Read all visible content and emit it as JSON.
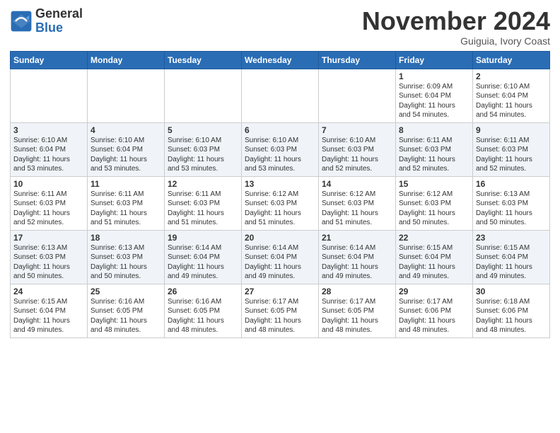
{
  "logo": {
    "general": "General",
    "blue": "Blue"
  },
  "header": {
    "month": "November 2024",
    "location": "Guiguia, Ivory Coast"
  },
  "weekdays": [
    "Sunday",
    "Monday",
    "Tuesday",
    "Wednesday",
    "Thursday",
    "Friday",
    "Saturday"
  ],
  "weeks": [
    [
      {
        "day": "",
        "info": ""
      },
      {
        "day": "",
        "info": ""
      },
      {
        "day": "",
        "info": ""
      },
      {
        "day": "",
        "info": ""
      },
      {
        "day": "",
        "info": ""
      },
      {
        "day": "1",
        "info": "Sunrise: 6:09 AM\nSunset: 6:04 PM\nDaylight: 11 hours\nand 54 minutes."
      },
      {
        "day": "2",
        "info": "Sunrise: 6:10 AM\nSunset: 6:04 PM\nDaylight: 11 hours\nand 54 minutes."
      }
    ],
    [
      {
        "day": "3",
        "info": "Sunrise: 6:10 AM\nSunset: 6:04 PM\nDaylight: 11 hours\nand 53 minutes."
      },
      {
        "day": "4",
        "info": "Sunrise: 6:10 AM\nSunset: 6:04 PM\nDaylight: 11 hours\nand 53 minutes."
      },
      {
        "day": "5",
        "info": "Sunrise: 6:10 AM\nSunset: 6:03 PM\nDaylight: 11 hours\nand 53 minutes."
      },
      {
        "day": "6",
        "info": "Sunrise: 6:10 AM\nSunset: 6:03 PM\nDaylight: 11 hours\nand 53 minutes."
      },
      {
        "day": "7",
        "info": "Sunrise: 6:10 AM\nSunset: 6:03 PM\nDaylight: 11 hours\nand 52 minutes."
      },
      {
        "day": "8",
        "info": "Sunrise: 6:11 AM\nSunset: 6:03 PM\nDaylight: 11 hours\nand 52 minutes."
      },
      {
        "day": "9",
        "info": "Sunrise: 6:11 AM\nSunset: 6:03 PM\nDaylight: 11 hours\nand 52 minutes."
      }
    ],
    [
      {
        "day": "10",
        "info": "Sunrise: 6:11 AM\nSunset: 6:03 PM\nDaylight: 11 hours\nand 52 minutes."
      },
      {
        "day": "11",
        "info": "Sunrise: 6:11 AM\nSunset: 6:03 PM\nDaylight: 11 hours\nand 51 minutes."
      },
      {
        "day": "12",
        "info": "Sunrise: 6:11 AM\nSunset: 6:03 PM\nDaylight: 11 hours\nand 51 minutes."
      },
      {
        "day": "13",
        "info": "Sunrise: 6:12 AM\nSunset: 6:03 PM\nDaylight: 11 hours\nand 51 minutes."
      },
      {
        "day": "14",
        "info": "Sunrise: 6:12 AM\nSunset: 6:03 PM\nDaylight: 11 hours\nand 51 minutes."
      },
      {
        "day": "15",
        "info": "Sunrise: 6:12 AM\nSunset: 6:03 PM\nDaylight: 11 hours\nand 50 minutes."
      },
      {
        "day": "16",
        "info": "Sunrise: 6:13 AM\nSunset: 6:03 PM\nDaylight: 11 hours\nand 50 minutes."
      }
    ],
    [
      {
        "day": "17",
        "info": "Sunrise: 6:13 AM\nSunset: 6:03 PM\nDaylight: 11 hours\nand 50 minutes."
      },
      {
        "day": "18",
        "info": "Sunrise: 6:13 AM\nSunset: 6:03 PM\nDaylight: 11 hours\nand 50 minutes."
      },
      {
        "day": "19",
        "info": "Sunrise: 6:14 AM\nSunset: 6:04 PM\nDaylight: 11 hours\nand 49 minutes."
      },
      {
        "day": "20",
        "info": "Sunrise: 6:14 AM\nSunset: 6:04 PM\nDaylight: 11 hours\nand 49 minutes."
      },
      {
        "day": "21",
        "info": "Sunrise: 6:14 AM\nSunset: 6:04 PM\nDaylight: 11 hours\nand 49 minutes."
      },
      {
        "day": "22",
        "info": "Sunrise: 6:15 AM\nSunset: 6:04 PM\nDaylight: 11 hours\nand 49 minutes."
      },
      {
        "day": "23",
        "info": "Sunrise: 6:15 AM\nSunset: 6:04 PM\nDaylight: 11 hours\nand 49 minutes."
      }
    ],
    [
      {
        "day": "24",
        "info": "Sunrise: 6:15 AM\nSunset: 6:04 PM\nDaylight: 11 hours\nand 49 minutes."
      },
      {
        "day": "25",
        "info": "Sunrise: 6:16 AM\nSunset: 6:05 PM\nDaylight: 11 hours\nand 48 minutes."
      },
      {
        "day": "26",
        "info": "Sunrise: 6:16 AM\nSunset: 6:05 PM\nDaylight: 11 hours\nand 48 minutes."
      },
      {
        "day": "27",
        "info": "Sunrise: 6:17 AM\nSunset: 6:05 PM\nDaylight: 11 hours\nand 48 minutes."
      },
      {
        "day": "28",
        "info": "Sunrise: 6:17 AM\nSunset: 6:05 PM\nDaylight: 11 hours\nand 48 minutes."
      },
      {
        "day": "29",
        "info": "Sunrise: 6:17 AM\nSunset: 6:06 PM\nDaylight: 11 hours\nand 48 minutes."
      },
      {
        "day": "30",
        "info": "Sunrise: 6:18 AM\nSunset: 6:06 PM\nDaylight: 11 hours\nand 48 minutes."
      }
    ]
  ]
}
